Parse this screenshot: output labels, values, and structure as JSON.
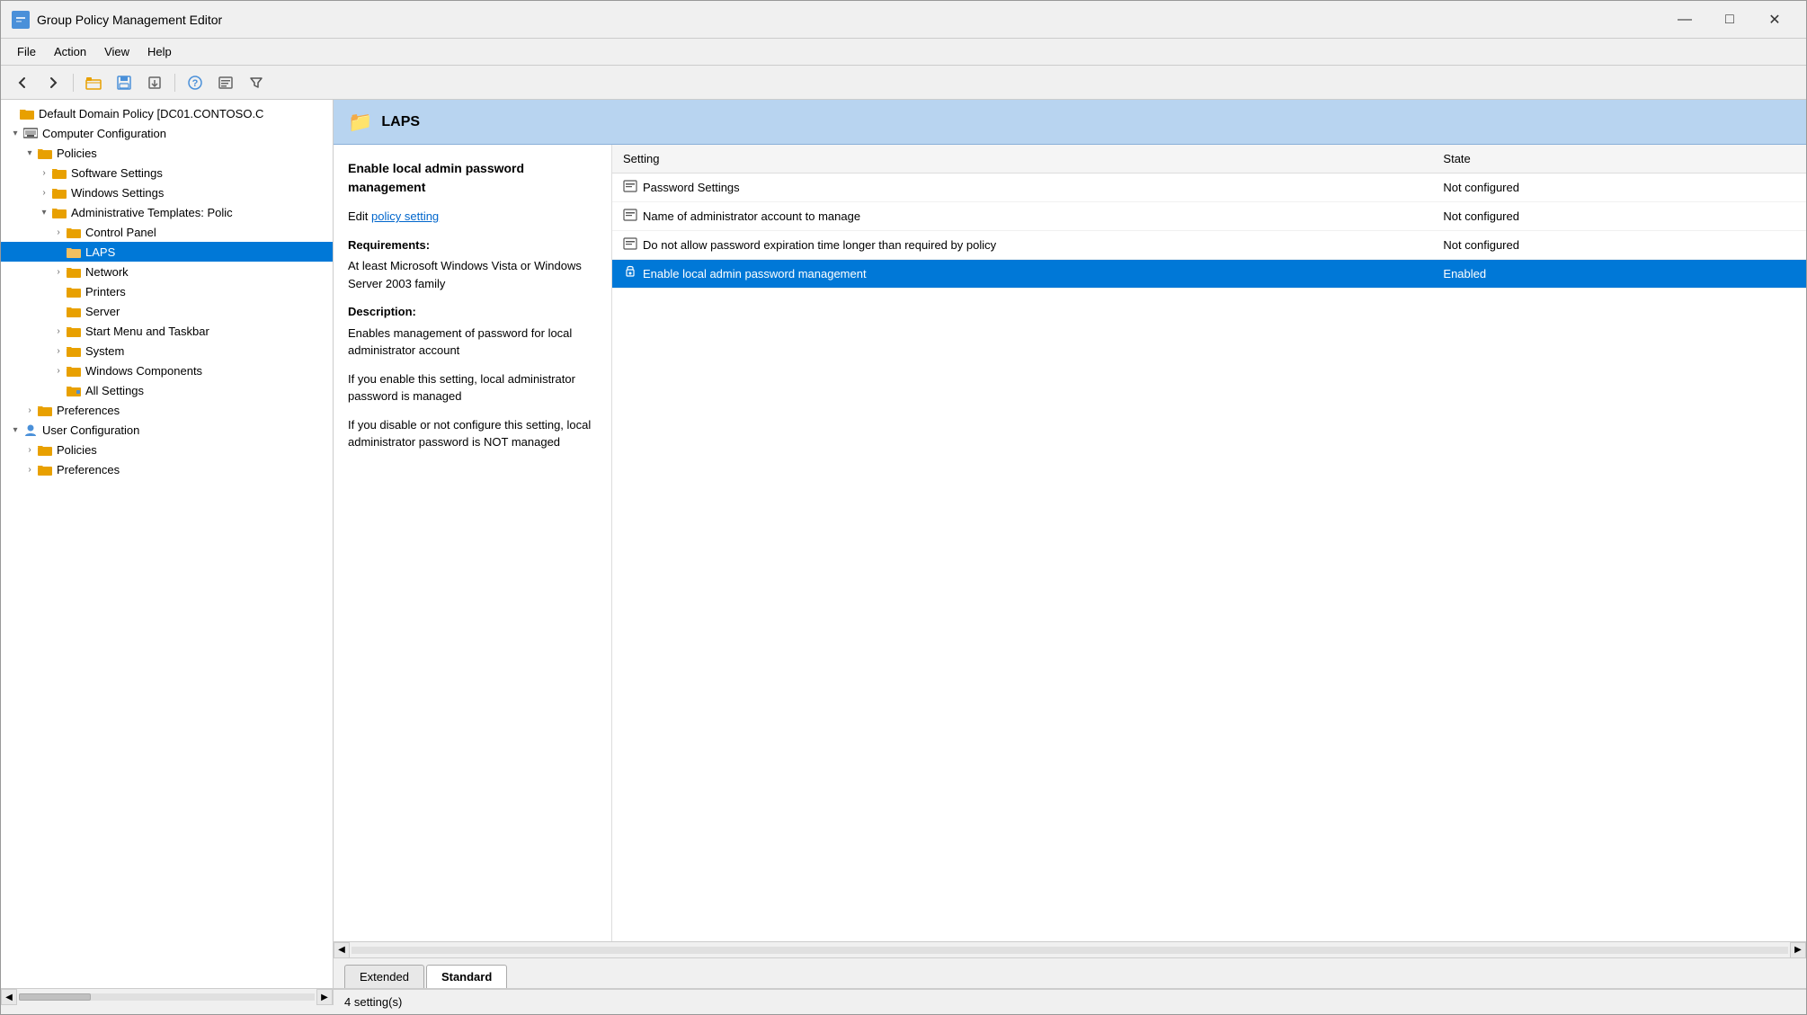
{
  "window": {
    "title": "Group Policy Management Editor",
    "min_btn": "—",
    "max_btn": "□",
    "close_btn": "✕"
  },
  "menu": {
    "items": [
      "File",
      "Action",
      "View",
      "Help"
    ]
  },
  "toolbar": {
    "buttons": [
      "◀",
      "▶",
      "📁",
      "💾",
      "🔄",
      "❓",
      "📋",
      "⚡"
    ]
  },
  "tree": {
    "root_label": "Default Domain Policy [DC01.CONTOSO.C",
    "nodes": [
      {
        "id": "computer-config",
        "label": "Computer Configuration",
        "level": 1,
        "expanded": true,
        "icon": "computer",
        "expander": "▾"
      },
      {
        "id": "policies-cc",
        "label": "Policies",
        "level": 2,
        "expanded": true,
        "icon": "folder",
        "expander": "▾"
      },
      {
        "id": "software-settings",
        "label": "Software Settings",
        "level": 3,
        "expanded": false,
        "icon": "folder",
        "expander": "›"
      },
      {
        "id": "windows-settings",
        "label": "Windows Settings",
        "level": 3,
        "expanded": false,
        "icon": "folder",
        "expander": "›"
      },
      {
        "id": "admin-templates",
        "label": "Administrative Templates: Polic",
        "level": 3,
        "expanded": true,
        "icon": "folder",
        "expander": "▾"
      },
      {
        "id": "control-panel",
        "label": "Control Panel",
        "level": 4,
        "expanded": false,
        "icon": "folder",
        "expander": "›"
      },
      {
        "id": "laps",
        "label": "LAPS",
        "level": 4,
        "expanded": false,
        "icon": "folder-open",
        "expander": "",
        "selected": true
      },
      {
        "id": "network",
        "label": "Network",
        "level": 4,
        "expanded": false,
        "icon": "folder",
        "expander": "›"
      },
      {
        "id": "printers",
        "label": "Printers",
        "level": 4,
        "expanded": false,
        "icon": "folder",
        "expander": ""
      },
      {
        "id": "server",
        "label": "Server",
        "level": 4,
        "expanded": false,
        "icon": "folder",
        "expander": ""
      },
      {
        "id": "start-menu",
        "label": "Start Menu and Taskbar",
        "level": 4,
        "expanded": false,
        "icon": "folder",
        "expander": "›"
      },
      {
        "id": "system",
        "label": "System",
        "level": 4,
        "expanded": false,
        "icon": "folder",
        "expander": "›"
      },
      {
        "id": "windows-components",
        "label": "Windows Components",
        "level": 4,
        "expanded": false,
        "icon": "folder",
        "expander": "›"
      },
      {
        "id": "all-settings",
        "label": "All Settings",
        "level": 4,
        "expanded": false,
        "icon": "folder-special",
        "expander": ""
      },
      {
        "id": "preferences-cc",
        "label": "Preferences",
        "level": 2,
        "expanded": false,
        "icon": "folder",
        "expander": "›"
      },
      {
        "id": "user-config",
        "label": "User Configuration",
        "level": 1,
        "expanded": true,
        "icon": "user",
        "expander": "▾"
      },
      {
        "id": "policies-uc",
        "label": "Policies",
        "level": 2,
        "expanded": false,
        "icon": "folder",
        "expander": "›"
      },
      {
        "id": "preferences-uc",
        "label": "Preferences",
        "level": 2,
        "expanded": false,
        "icon": "folder",
        "expander": "›"
      }
    ]
  },
  "detail": {
    "header_icon": "📁",
    "header_title": "LAPS",
    "description_title": "Enable local admin password management",
    "policy_link_text": "policy setting",
    "edit_prefix": "Edit ",
    "requirements_label": "Requirements:",
    "requirements_text": "At least Microsoft Windows Vista or Windows Server 2003 family",
    "description_label": "Description:",
    "description_body": "Enables management of password for local administrator account",
    "description_body2": "If you enable this setting, local administrator password is managed",
    "description_body3": "If you disable or not configure this setting, local administrator password is NOT managed"
  },
  "table": {
    "columns": [
      "Setting",
      "State"
    ],
    "rows": [
      {
        "icon": "📋",
        "name": "Password Settings",
        "state": "Not configured",
        "selected": false
      },
      {
        "icon": "📋",
        "name": "Name of administrator account to manage",
        "state": "Not configured",
        "selected": false
      },
      {
        "icon": "📋",
        "name": "Do not allow password expiration time longer than required by policy",
        "state": "Not configured",
        "selected": false
      },
      {
        "icon": "🔒",
        "name": "Enable local admin password management",
        "state": "Enabled",
        "selected": true
      }
    ]
  },
  "tabs": [
    {
      "id": "extended",
      "label": "Extended",
      "active": false
    },
    {
      "id": "standard",
      "label": "Standard",
      "active": true
    }
  ],
  "status": {
    "text": "4 setting(s)"
  }
}
